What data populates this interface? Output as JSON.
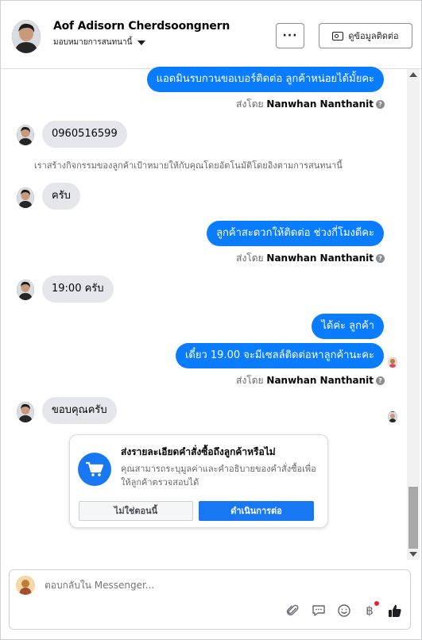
{
  "header": {
    "user_name": "Aof Adisorn Cherdsoongnern",
    "assign_label": "มอบหมายการสนทนานี้",
    "more_label": "···",
    "contact_label": "ดูข้อมูลติดต่อ"
  },
  "messages": {
    "m1": "แอดมินรบกวนขอเบอร์ติดต่อ ลูกค้าหน่อยได้มั้ยคะ",
    "m2": "0960516599",
    "system_note": "เราสร้างกิจกรรมของลูกค้าเป้าหมายให้กับคุณโดยอัตโนมัติโดยอิงตามการสนทนานี้",
    "m3": "ครับ",
    "m4": "ลูกค้าสะดวกให้ติดต่อ ช่วงกี่โมงดีคะ",
    "m5": "19:00 ครับ",
    "m6": "ได้ค่ะ ลูกค้า",
    "m7": "เดี๋ยว 19.00 จะมีเซลล์ติดต่อหาลูกค้านะคะ",
    "m8": "ขอบคุณครับ"
  },
  "sent_by": {
    "prefix": "ส่งโดย",
    "name": "Nanwhan Nanthanit",
    "help": "?"
  },
  "suggestion": {
    "title": "ส่งรายละเอียดคำสั่งซื้อถึงลูกค้าหรือไม่",
    "description": "คุณสามารถระบุมูลค่าและคำอธิบายของคำสั่งซื้อเพื่อให้ลูกค้าตรวจสอบได้",
    "not_now": "ไม่ใช่ตอนนี้",
    "continue": "ดำเนินการต่อ"
  },
  "composer": {
    "placeholder": "ตอบกลับใน Messenger...",
    "baht_symbol": "฿"
  },
  "icons": [
    "more-icon",
    "contact-card-icon",
    "cart-icon",
    "attach-icon",
    "saved-reply-icon",
    "emoji-icon",
    "baht-icon",
    "thumbs-up-icon",
    "help-icon"
  ],
  "colors": {
    "outgoing_bubble": "#0a7cff",
    "incoming_bubble": "#e4e6eb",
    "primary_button": "#1877f2",
    "notification_dot": "#e41e3f"
  }
}
